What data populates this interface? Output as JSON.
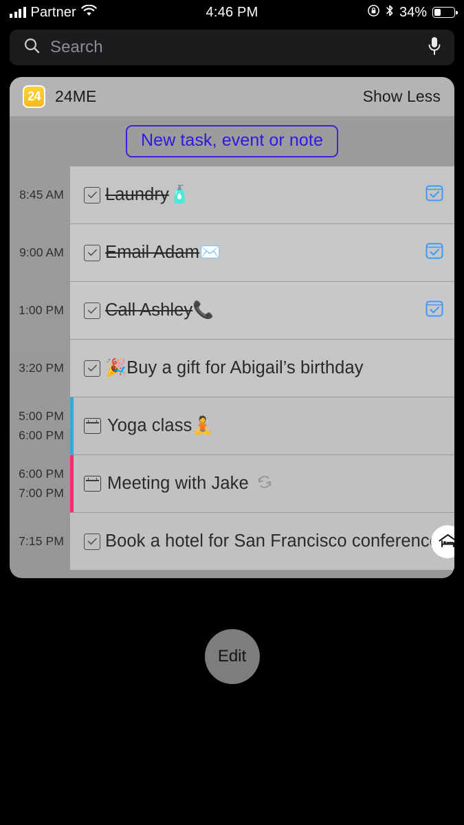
{
  "status_bar": {
    "carrier": "Partner",
    "time": "4:46 PM",
    "battery_percent": "34%",
    "signal_icon": "cellular-signal-icon",
    "wifi_icon": "wifi-icon",
    "rotation_lock_icon": "rotation-lock-icon",
    "bluetooth_icon": "bluetooth-icon",
    "battery_icon": "battery-icon",
    "battery_level": 34
  },
  "search": {
    "placeholder": "Search",
    "value": "",
    "search_icon": "search-icon",
    "mic_icon": "microphone-icon"
  },
  "widget": {
    "app_icon_label": "24",
    "app_name": "24ME",
    "show_less_label": "Show Less",
    "new_item_label": "New task, event or note",
    "accent_color": "#2d1ae0",
    "header_bg": "#b4b4b4",
    "rows": [
      {
        "type": "task",
        "times": [
          "8:45 AM"
        ],
        "title": "Laundry",
        "emoji": "🧴",
        "completed": true,
        "checkbox_icon": "checkbox-checked-icon",
        "trailing_icon": "task-list-icon",
        "trailing_color": "#3c9bf0"
      },
      {
        "type": "task",
        "times": [
          "9:00 AM"
        ],
        "title": "Email Adam",
        "emoji": "✉️",
        "completed": true,
        "checkbox_icon": "checkbox-checked-icon",
        "trailing_icon": "task-list-icon",
        "trailing_color": "#3c9bf0"
      },
      {
        "type": "task",
        "times": [
          "1:00 PM"
        ],
        "title": "Call Ashley",
        "emoji": "📞",
        "completed": true,
        "checkbox_icon": "checkbox-checked-icon",
        "trailing_icon": "task-list-icon",
        "trailing_color": "#3c9bf0"
      },
      {
        "type": "task",
        "times": [
          "3:20 PM"
        ],
        "title": "Buy a gift for Abigail’s birthday",
        "emoji": "🎉",
        "emoji_leading": true,
        "completed": false,
        "checkbox_icon": "checkbox-checked-icon"
      },
      {
        "type": "event",
        "times": [
          "5:00 PM",
          "6:00 PM"
        ],
        "title": "Yoga class",
        "emoji": "🧘",
        "bar_color": "#34aadc",
        "calendar_icon": "calendar-icon"
      },
      {
        "type": "event",
        "times": [
          "6:00 PM",
          "7:00 PM"
        ],
        "title": "Meeting with Jake",
        "bar_color": "#ff2d6b",
        "calendar_icon": "calendar-icon",
        "repeat_icon": "repeat-icon"
      },
      {
        "type": "task",
        "times": [
          "7:15 PM"
        ],
        "title": "Book a hotel for San Francisco conference",
        "completed": false,
        "checkbox_icon": "checkbox-checked-icon",
        "badge_icon": "hotel-icon"
      }
    ]
  },
  "edit": {
    "label": "Edit"
  }
}
